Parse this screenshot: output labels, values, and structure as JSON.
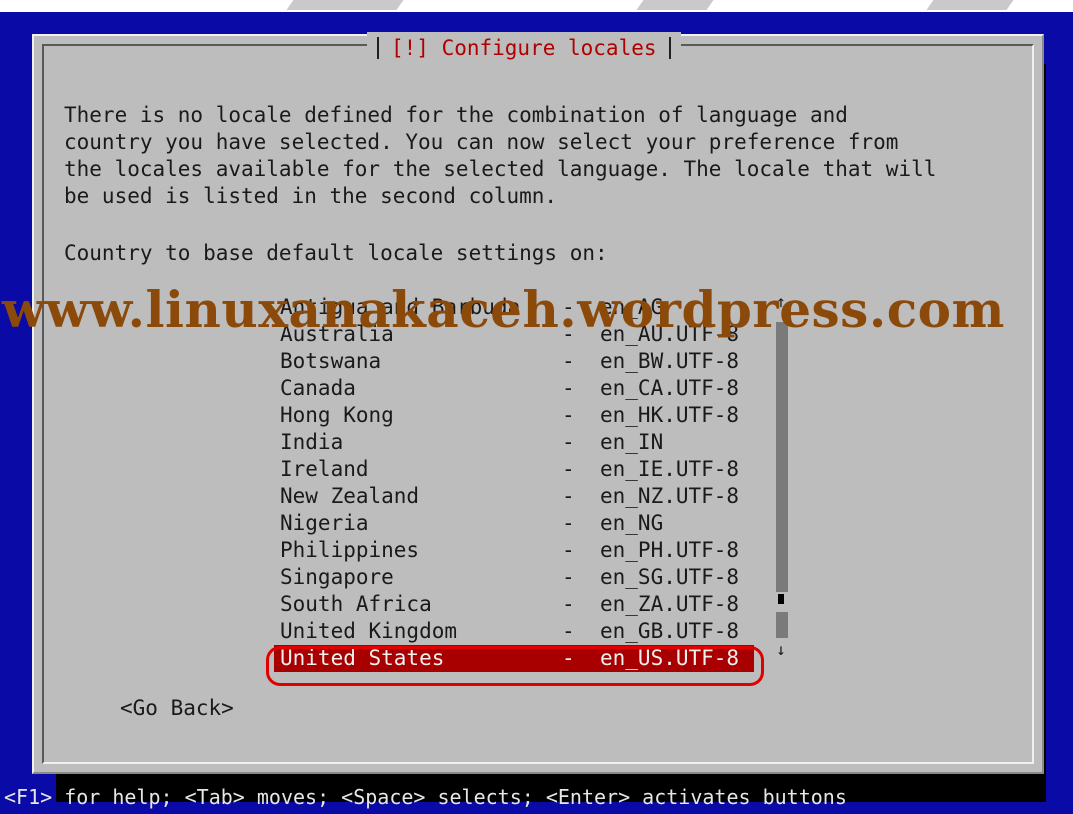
{
  "dialog": {
    "title": "[!] Configure locales",
    "message": "There is no locale defined for the combination of language and\ncountry you have selected. You can now select your preference from\nthe locales available for the selected language. The locale that will\nbe used is listed in the second column.",
    "prompt": "Country to base default locale settings on:",
    "locales": [
      {
        "country": "Antigua and Barbuda",
        "dash": "-",
        "locale": "en_AG"
      },
      {
        "country": "Australia",
        "dash": "-",
        "locale": "en_AU.UTF-8"
      },
      {
        "country": "Botswana",
        "dash": "-",
        "locale": "en_BW.UTF-8"
      },
      {
        "country": "Canada",
        "dash": "-",
        "locale": "en_CA.UTF-8"
      },
      {
        "country": "Hong Kong",
        "dash": "-",
        "locale": "en_HK.UTF-8"
      },
      {
        "country": "India",
        "dash": "-",
        "locale": "en_IN"
      },
      {
        "country": "Ireland",
        "dash": "-",
        "locale": "en_IE.UTF-8"
      },
      {
        "country": "New Zealand",
        "dash": "-",
        "locale": "en_NZ.UTF-8"
      },
      {
        "country": "Nigeria",
        "dash": "-",
        "locale": "en_NG"
      },
      {
        "country": "Philippines",
        "dash": "-",
        "locale": "en_PH.UTF-8"
      },
      {
        "country": "Singapore",
        "dash": "-",
        "locale": "en_SG.UTF-8"
      },
      {
        "country": "South Africa",
        "dash": "-",
        "locale": "en_ZA.UTF-8"
      },
      {
        "country": "United Kingdom",
        "dash": "-",
        "locale": "en_GB.UTF-8"
      },
      {
        "country": "United States",
        "dash": "-",
        "locale": "en_US.UTF-8"
      }
    ],
    "selected_index": 13,
    "go_back_label": "<Go Back>",
    "scroll_up_icon": "↑",
    "scroll_down_icon": "↓"
  },
  "watermark": "www.linuxanakaceh.wordpress.com",
  "help_bar": "<F1> for help; <Tab> moves; <Space> selects; <Enter> activates buttons",
  "colors": {
    "screen_background": "#0a0aa6",
    "dialog_background": "#bdbdbd",
    "title_text": "#b00000",
    "selection_background": "#a80000",
    "highlight_ring": "#e00000",
    "watermark": "#8c4a0a"
  }
}
